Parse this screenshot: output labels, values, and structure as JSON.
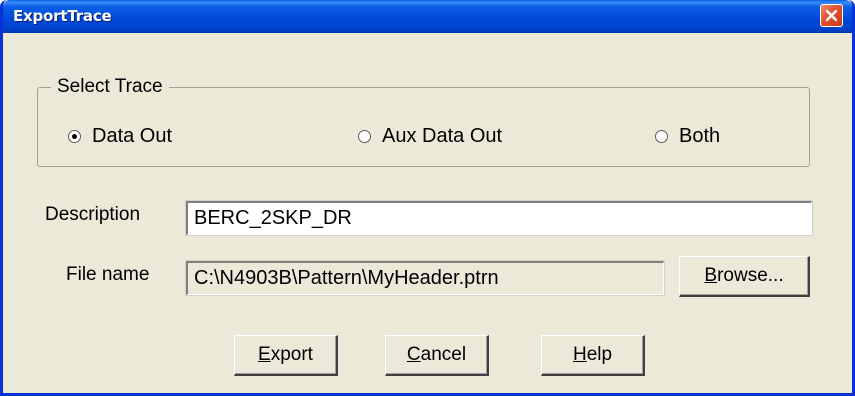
{
  "window": {
    "title": "ExportTrace",
    "titlebar_color": "#0048d8",
    "body_color": "#ece9d8"
  },
  "select_trace": {
    "legend": "Select Trace",
    "options": [
      {
        "label": "Data Out",
        "checked": true
      },
      {
        "label": "Aux Data Out",
        "checked": false
      },
      {
        "label": "Both",
        "checked": false
      }
    ]
  },
  "description": {
    "label": "Description",
    "value": "BERC_2SKP_DR"
  },
  "file_name": {
    "label": "File name",
    "value": "C:\\N4903B\\Pattern\\MyHeader.ptrn",
    "browse": {
      "mnemonic": "B",
      "rest": "rowse..."
    }
  },
  "buttons": {
    "export": {
      "mnemonic": "E",
      "rest": "xport"
    },
    "cancel": {
      "mnemonic": "C",
      "rest": "ancel"
    },
    "help": {
      "mnemonic": "H",
      "rest": "elp"
    }
  },
  "icons": {
    "close": "close-icon"
  }
}
